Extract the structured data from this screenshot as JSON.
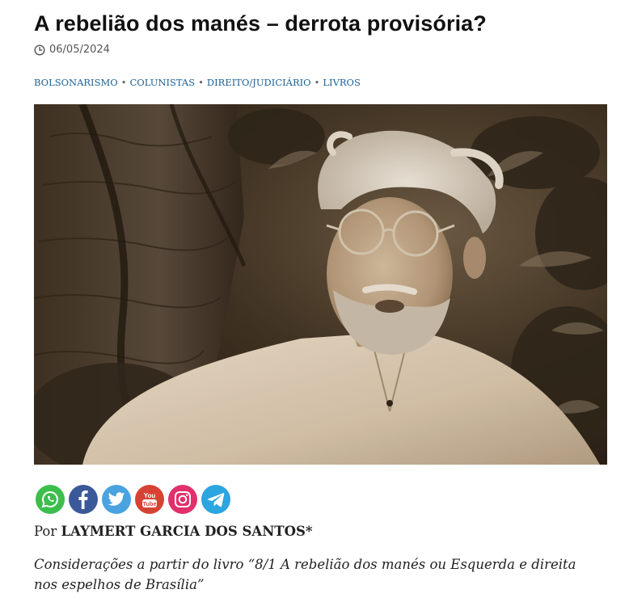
{
  "article": {
    "title": "A rebelião dos manés – derrota provisória?",
    "date": "06/05/2024",
    "categories": [
      "BOLSONARISMO",
      "COLUNISTAS",
      "DIREITO/JUDICIÁRIO",
      "LIVROS"
    ],
    "category_separator": "•",
    "image_icon": "portrait-photo",
    "byline_prefix": "Por",
    "author": "LAYMERT GARCIA DOS SANTOS*",
    "lead": "Considerações a partir do livro “8/1 A rebelião dos manés ou Esquerda e direita nos espelhos de Brasília”"
  },
  "share": [
    {
      "name": "whatsapp",
      "icon": "whatsapp-icon",
      "color": "#3cbe4c"
    },
    {
      "name": "facebook",
      "icon": "facebook-icon",
      "color": "#3b5998"
    },
    {
      "name": "twitter",
      "icon": "twitter-icon",
      "color": "#4aa3df"
    },
    {
      "name": "youtube",
      "icon": "youtube-icon",
      "color": "#d84235",
      "text": "You Tube"
    },
    {
      "name": "instagram",
      "icon": "instagram-icon",
      "color": "#e1306c"
    },
    {
      "name": "telegram",
      "icon": "telegram-icon",
      "color": "#2ca5e0"
    }
  ],
  "colors": {
    "category_link": "#1b5f94",
    "title": "#111111"
  }
}
